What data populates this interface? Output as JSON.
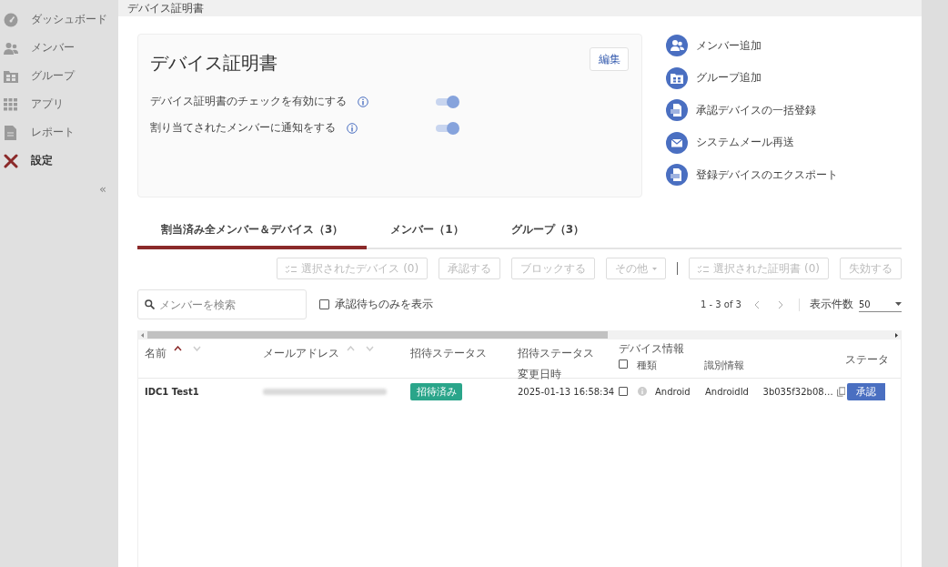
{
  "sidebar": {
    "items": [
      {
        "label": "ダッシュボード",
        "selected": false
      },
      {
        "label": "メンバー",
        "selected": false
      },
      {
        "label": "グループ",
        "selected": false
      },
      {
        "label": "アプリ",
        "selected": false
      },
      {
        "label": "レポート",
        "selected": false
      },
      {
        "label": "設定",
        "selected": true
      }
    ],
    "collapse": "«"
  },
  "breadcrumb": "デバイス証明書",
  "card": {
    "title": "デバイス証明書",
    "edit_button": "編集",
    "settings": [
      {
        "label": "デバイス証明書のチェックを有効にする",
        "on": true
      },
      {
        "label": "割り当てされたメンバーに通知をする",
        "on": true
      }
    ]
  },
  "actions": [
    {
      "label": "メンバー追加"
    },
    {
      "label": "グループ追加"
    },
    {
      "label": "承認デバイスの一括登録"
    },
    {
      "label": "システムメール再送"
    },
    {
      "label": "登録デバイスのエクスポート"
    }
  ],
  "tabs": [
    {
      "label": "割当済み全メンバー＆デバイス（3）",
      "selected": true
    },
    {
      "label": "メンバー（1）",
      "selected": false
    },
    {
      "label": "グループ（3）",
      "selected": false
    }
  ],
  "toolbar": {
    "buttons": [
      {
        "label": "選択されたデバイス (0)",
        "kind": "checklist",
        "disabled": true
      },
      {
        "label": "承認する",
        "kind": "plain",
        "disabled": true
      },
      {
        "label": "ブロックする",
        "kind": "plain",
        "disabled": true
      },
      {
        "label": "その他",
        "kind": "dropdown",
        "disabled": true
      },
      {
        "label": "選択された証明書 (0)",
        "kind": "checklist",
        "disabled": true
      },
      {
        "label": "失効する",
        "kind": "plain",
        "disabled": true
      }
    ]
  },
  "search": {
    "placeholder": "メンバーを検索"
  },
  "filter": {
    "label": "承認待ちのみを表示",
    "checked": false
  },
  "pagination": {
    "range": "1 - 3 of 3",
    "page_size_label": "表示件数",
    "page_size": "50"
  },
  "table": {
    "columns": [
      {
        "label": "名前",
        "sorted": true
      },
      {
        "label": "メールアドレス",
        "sorted": false
      },
      {
        "label": "招待ステータス"
      },
      {
        "label": "招待ステータス",
        "sublabel": "変更日時"
      },
      {
        "label": "デバイス情報",
        "select_all": false,
        "subcolumns": [
          "種類",
          "識別情報"
        ]
      },
      {
        "label": "ステータ"
      }
    ],
    "rows": [
      {
        "name": "IDC1 Test1",
        "invite_status": "招待済み",
        "changed_at": "2025-01-13 16:58:34",
        "checked": false,
        "device_type": "Android",
        "identifier": "AndroidId",
        "identifier_value": "3b035f32b08…",
        "status": "承認"
      }
    ]
  }
}
